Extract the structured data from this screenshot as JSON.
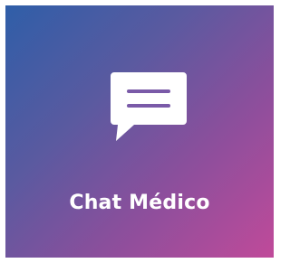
{
  "tile": {
    "label": "Chat Médico",
    "icon": "chat-bubble-icon",
    "colors": {
      "gradient_start": "#2f5ea8",
      "gradient_mid": "#8a4f9c",
      "gradient_end": "#c04a9a",
      "text": "#ffffff"
    }
  }
}
